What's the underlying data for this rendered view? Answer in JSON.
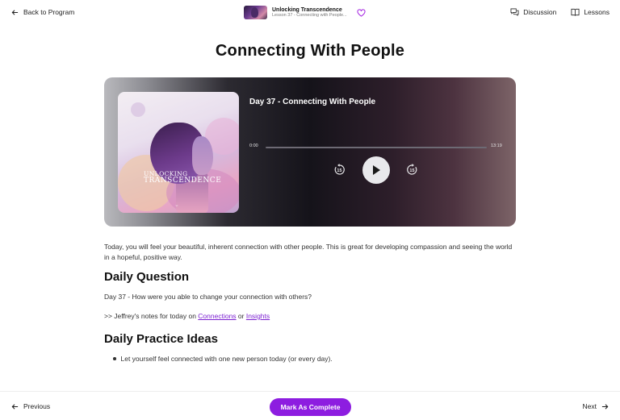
{
  "header": {
    "back_label": "Back to Program",
    "program_title": "Unlocking Transcendence",
    "lesson_subtitle": "Lesson 37 - Connecting with People...",
    "discussion_label": "Discussion",
    "lessons_label": "Lessons"
  },
  "page": {
    "title": "Connecting With People"
  },
  "player": {
    "cover_line1": "UNLOCKING",
    "cover_line2": "TRANSCENDENCE",
    "track_title": "Day 37 - Connecting With People",
    "current_time": "0:00",
    "duration": "13:19",
    "progress_fraction": 0,
    "rewind_seconds": "15",
    "forward_seconds": "15"
  },
  "content": {
    "intro": "Today, you will feel your beautiful, inherent connection with other people. This is great for developing compassion and seeing the world in a hopeful, positive way.",
    "daily_question_heading": "Daily Question",
    "daily_question": "Day 37 - How were you able to change your connection with others?",
    "notes_prefix": ">> Jeffrey's notes for today on ",
    "notes_link1": "Connections",
    "notes_or": " or ",
    "notes_link2": "Insights",
    "practice_heading": "Daily Practice Ideas",
    "practice_items": [
      "Let yourself feel connected with one new person today (or every day)."
    ]
  },
  "footer": {
    "previous_label": "Previous",
    "complete_label": "Mark As Complete",
    "next_label": "Next"
  },
  "colors": {
    "accent": "#8d1de0",
    "link": "#7b1fd1"
  }
}
